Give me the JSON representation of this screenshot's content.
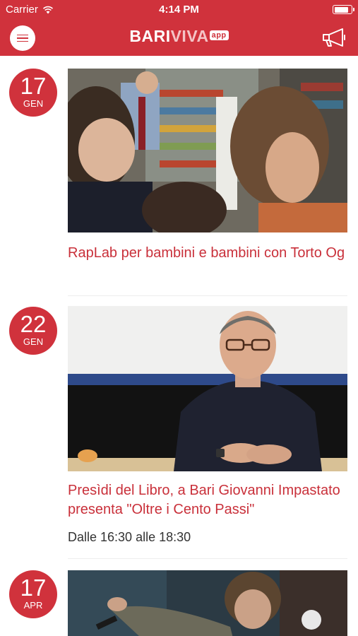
{
  "status_bar": {
    "carrier": "Carrier",
    "time": "4:14 PM",
    "battery_level": 0.9
  },
  "header": {
    "logo_part1": "BARI",
    "logo_part2": "VIVA",
    "logo_badge": "app",
    "menu_icon": "hamburger-icon",
    "action_icon": "megaphone-icon",
    "accent_color": "#d0323c"
  },
  "events": [
    {
      "day": "17",
      "month": "GEN",
      "title": "RapLab per bambini e bambini con Torto Og",
      "time": ""
    },
    {
      "day": "22",
      "month": "GEN",
      "title": "Presìdi del Libro, a Bari Giovanni Impastato presenta \"Oltre i Cento Passi\"",
      "time": "Dalle 16:30 alle 18:30"
    },
    {
      "day": "17",
      "month": "APR",
      "title": "",
      "time": ""
    }
  ]
}
